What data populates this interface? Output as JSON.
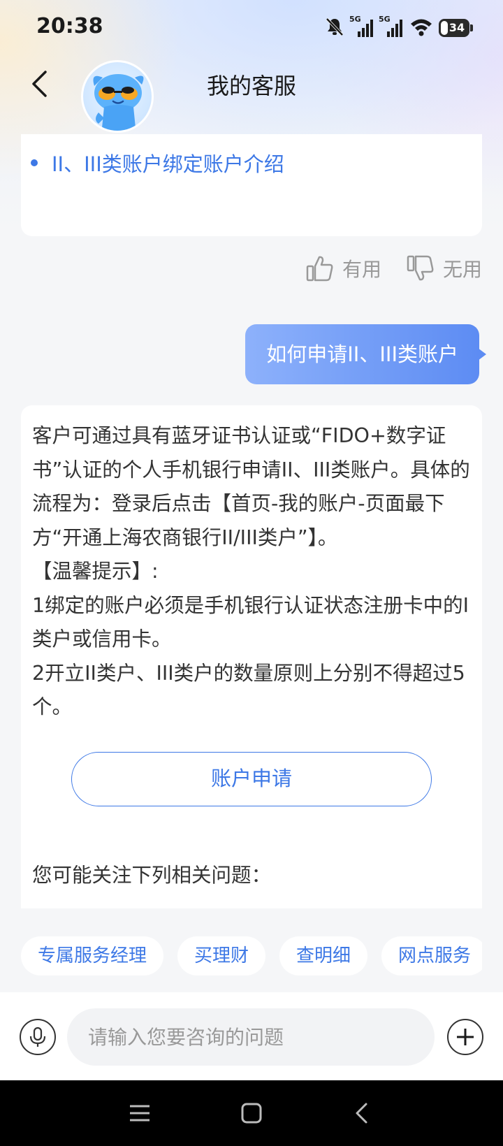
{
  "status_bar": {
    "time": "20:38",
    "network_1": "5G",
    "network_2": "5G",
    "battery": "34"
  },
  "header": {
    "title": "我的客服",
    "back_icon": "chevron-left-icon",
    "avatar_icon": "mascot-avatar"
  },
  "previous_answer": {
    "link_items": [
      "II、III类账户绑定账户介绍"
    ]
  },
  "feedback": {
    "useful_label": "有用",
    "useless_label": "无用"
  },
  "user_message": "如何申请II、III类账户",
  "answer": {
    "text": "客户可通过具有蓝牙证书认证或“FIDO+数字证书”认证的个人手机银行申请II、III类账户。具体的流程为：登录后点击【首页-我的账户-页面最下方“开通上海农商银行II/III类户”】。\n【温馨提示】:\n1绑定的账户必须是手机银行认证状态注册卡中的I类户或信用卡。\n2开立II类户、III类户的数量原则上分别不得超过5个。",
    "action_button": "账户申请",
    "related_label": "您可能关注下列相关问题："
  },
  "quick_chips": [
    "专属服务经理",
    "买理财",
    "查明细",
    "网点服务"
  ],
  "input_bar": {
    "placeholder": "请输入您要咨询的问题",
    "mic_icon": "microphone-icon",
    "add_icon": "plus-circle-icon"
  },
  "colors": {
    "accent": "#3d78e6",
    "bubble_start": "#8db1fb",
    "bubble_end": "#5d8cf3",
    "page_bg": "#f5f6f8"
  }
}
